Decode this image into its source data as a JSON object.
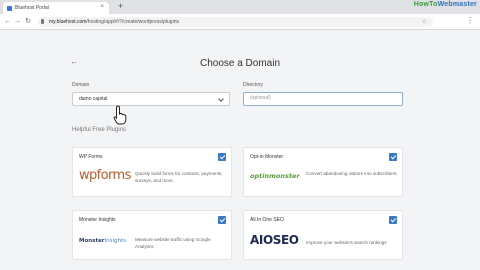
{
  "browser": {
    "tab_title": "Bluehost Portal",
    "tab_close": "×",
    "new_tab": "+",
    "url_host": "my.bluehost.com",
    "url_path": "/hosting/app/#/?/create/wordpress/plugins",
    "watermark_part1": "HowTo",
    "watermark_part2": "Webmaster"
  },
  "page": {
    "title": "Choose a Domain",
    "domain_label": "Domain",
    "domain_value": "damo capital",
    "directory_label": "Directory",
    "directory_placeholder": "(optional)",
    "plugins_heading": "Helpful Free Plugins"
  },
  "plugins": [
    {
      "name": "WP Forms",
      "logo": "wpforms",
      "desc": "Quickly build forms for contacts, payments, surveys, and more.",
      "checked": true
    },
    {
      "name": "Opt-in Monster",
      "logo": "optinmonster",
      "desc": "Convert abandoning visitors into subscribers.",
      "checked": true
    },
    {
      "name": "Monster Insights",
      "logo_part1": "Monster",
      "logo_part2": "Insights",
      "desc": "Measure website traffic using Google Analytics.",
      "checked": true
    },
    {
      "name": "All In One SEO",
      "logo": "AIOSEO",
      "desc": "Improve your website's search rankings",
      "checked": true
    }
  ],
  "colors": {
    "accent": "#3d78c7",
    "wpforms": "#b85a2a",
    "optinmonster": "#5a9e3a",
    "aioseo": "#1d2b52"
  }
}
